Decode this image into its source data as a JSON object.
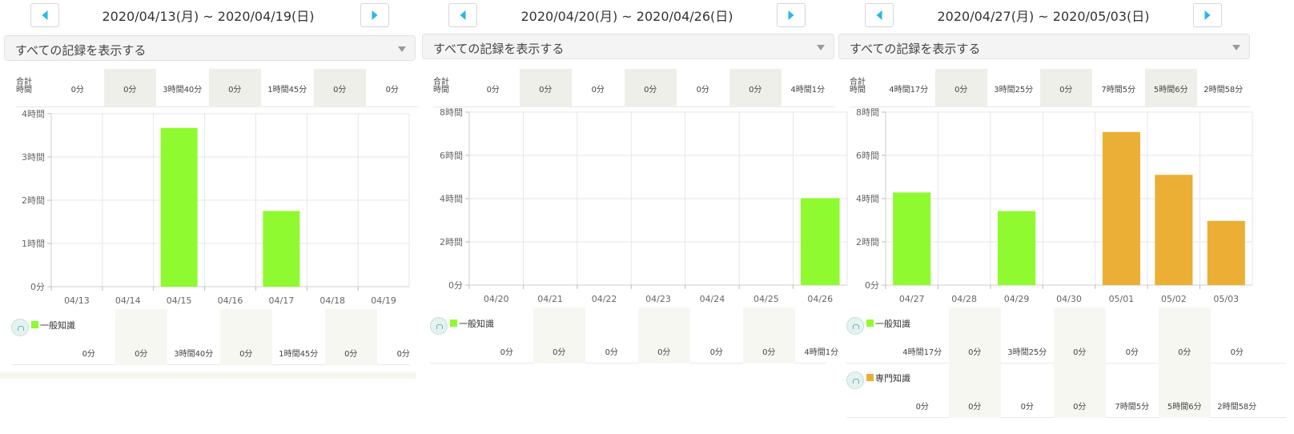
{
  "colors": {
    "general": "#8ffa2f",
    "special": "#ecaf35",
    "accent": "#29b6e6"
  },
  "weeks": [
    {
      "date_range": "2020/04/13(月) ~ 2020/04/19(日)",
      "filter": "すべての記録を表示する",
      "total_label": "合計\n時間",
      "totals": [
        "0分",
        "0分",
        "3時間40分",
        "0分",
        "1時間45分",
        "0分",
        "0分"
      ],
      "chart_data": {
        "type": "bar",
        "categories": [
          "04/13",
          "04/14",
          "04/15",
          "04/16",
          "04/17",
          "04/18",
          "04/19"
        ],
        "y_ticks": [
          "0分",
          "1時間",
          "2時間",
          "3時間",
          "4時間"
        ],
        "ylim": [
          0,
          4
        ],
        "series": [
          {
            "name": "一般知識",
            "color": "#8ffa2f",
            "values": [
              0,
              0,
              3.67,
              0,
              1.75,
              0,
              0
            ]
          }
        ]
      },
      "subjects": [
        {
          "name": "一般知識",
          "color": "#8ffa2f",
          "values": [
            "0分",
            "0分",
            "3時間40分",
            "0分",
            "1時間45分",
            "0分",
            "0分"
          ]
        }
      ]
    },
    {
      "date_range": "2020/04/20(月) ~ 2020/04/26(日)",
      "filter": "すべての記録を表示する",
      "total_label": "合計\n時間",
      "totals": [
        "0分",
        "0分",
        "0分",
        "0分",
        "0分",
        "0分",
        "4時間1分"
      ],
      "chart_data": {
        "type": "bar",
        "categories": [
          "04/20",
          "04/21",
          "04/22",
          "04/23",
          "04/24",
          "04/25",
          "04/26"
        ],
        "y_ticks": [
          "0分",
          "2時間",
          "4時間",
          "6時間",
          "8時間"
        ],
        "ylim": [
          0,
          8
        ],
        "series": [
          {
            "name": "一般知識",
            "color": "#8ffa2f",
            "values": [
              0,
              0,
              0,
              0,
              0,
              0,
              4.02
            ]
          }
        ]
      },
      "subjects": [
        {
          "name": "一般知識",
          "color": "#8ffa2f",
          "values": [
            "0分",
            "0分",
            "0分",
            "0分",
            "0分",
            "0分",
            "4時間1分"
          ]
        }
      ]
    },
    {
      "date_range": "2020/04/27(月) ~ 2020/05/03(日)",
      "filter": "すべての記録を表示する",
      "total_label": "合計\n時間",
      "totals": [
        "4時間17分",
        "0分",
        "3時間25分",
        "0分",
        "7時間5分",
        "5時間6分",
        "2時間58分"
      ],
      "chart_data": {
        "type": "bar",
        "categories": [
          "04/27",
          "04/28",
          "04/29",
          "04/30",
          "05/01",
          "05/02",
          "05/03"
        ],
        "y_ticks": [
          "0分",
          "2時間",
          "4時間",
          "6時間",
          "8時間"
        ],
        "ylim": [
          0,
          8
        ],
        "series": [
          {
            "name": "一般知識",
            "color": "#8ffa2f",
            "values": [
              4.28,
              0,
              3.42,
              0,
              0,
              0,
              0
            ]
          },
          {
            "name": "専門知識",
            "color": "#ecaf35",
            "values": [
              0,
              0,
              0,
              0,
              7.08,
              5.1,
              2.97
            ]
          }
        ]
      },
      "subjects": [
        {
          "name": "一般知識",
          "color": "#8ffa2f",
          "values": [
            "4時間17分",
            "0分",
            "3時間25分",
            "0分",
            "0分",
            "0分",
            "0分"
          ]
        },
        {
          "name": "専門知識",
          "color": "#ecaf35",
          "values": [
            "0分",
            "0分",
            "0分",
            "0分",
            "7時間5分",
            "5時間6分",
            "2時間58分"
          ]
        }
      ]
    }
  ]
}
